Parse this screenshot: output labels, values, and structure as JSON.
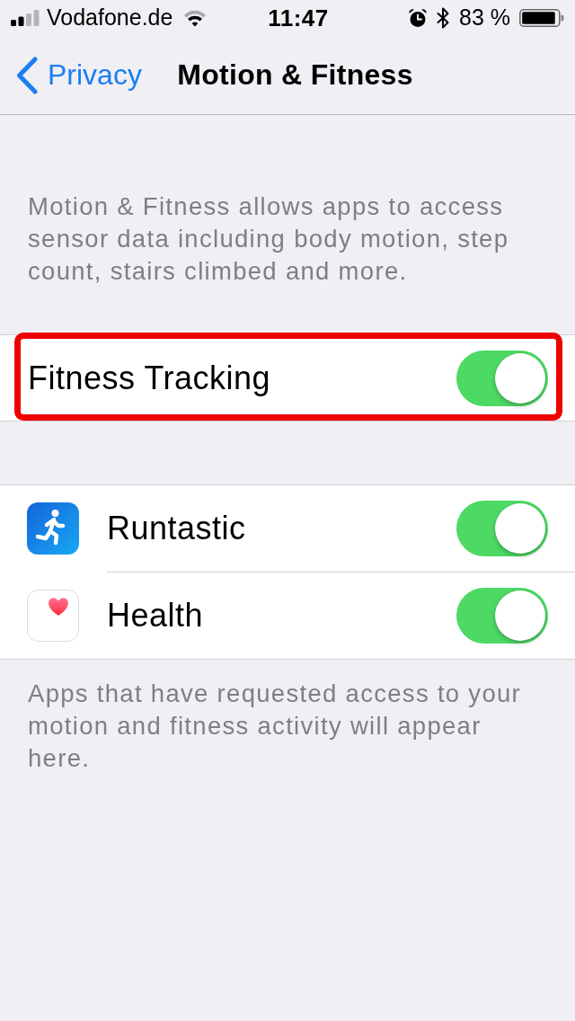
{
  "status_bar": {
    "carrier": "Vodafone.de",
    "time": "11:47",
    "battery": "83 %"
  },
  "nav_bar": {
    "back": "Privacy",
    "title": "Motion & Fitness"
  },
  "description": "Motion & Fitness allows apps to access sensor data including body motion, step count, stairs climbed and more.",
  "fitness_tracking": {
    "label": "Fitness Tracking",
    "on": true,
    "highlighted": true
  },
  "apps": [
    {
      "name": "Runtastic",
      "kind": "runner",
      "on": true
    },
    {
      "name": "Health",
      "kind": "heart",
      "on": true
    }
  ],
  "footer": "Apps that have requested access to your motion and fitness activity will appear here."
}
